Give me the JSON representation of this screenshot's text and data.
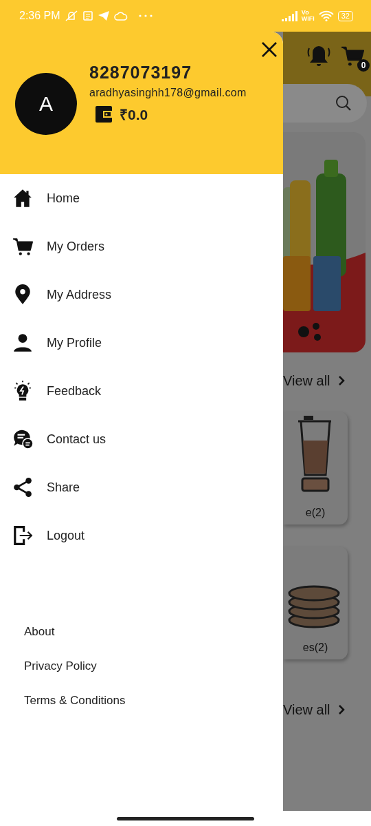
{
  "status_bar": {
    "time": "2:36 PM",
    "network_label_top": "Vo",
    "network_label_bottom": "WiFi",
    "battery": "32"
  },
  "drawer": {
    "avatar_letter": "A",
    "phone": "8287073197",
    "email": "aradhyasinghh178@gmail.com",
    "balance": "₹0.0",
    "menu": [
      {
        "label": "Home"
      },
      {
        "label": "My Orders"
      },
      {
        "label": "My Address"
      },
      {
        "label": "My Profile"
      },
      {
        "label": "Feedback"
      },
      {
        "label": "Contact us"
      },
      {
        "label": "Share"
      },
      {
        "label": "Logout"
      }
    ],
    "footer_links": [
      "About",
      "Privacy Policy",
      "Terms & Conditions"
    ]
  },
  "background": {
    "cart_count": "0",
    "sections": [
      {
        "kind": "banner",
        "view_all": "View all"
      },
      {
        "kind": "category",
        "label": "e(2)"
      },
      {
        "kind": "category",
        "label": "es(2)",
        "view_all": "View all"
      }
    ]
  }
}
